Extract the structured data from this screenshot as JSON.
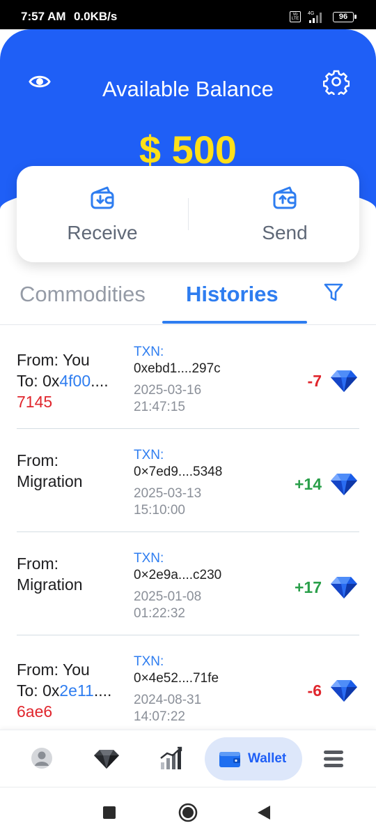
{
  "status_bar": {
    "time": "7:57 AM",
    "network_speed": "0.0KB/s",
    "volte": "Vo LTE",
    "network_type": "4G",
    "battery": "96"
  },
  "header": {
    "title": "Available Balance",
    "balance": "$ 500",
    "eye_icon": "eye-icon",
    "settings_icon": "gear-icon",
    "background_color": "#1f5ff6",
    "balance_color": "#ffe01a"
  },
  "actions": {
    "receive_label": "Receive",
    "send_label": "Send"
  },
  "tabs": {
    "commodities": "Commodities",
    "histories": "Histories",
    "active": "Histories",
    "accent_color": "#2e7df0"
  },
  "history": [
    {
      "from": "From: You",
      "to_prefix": "To: 0x",
      "to_highlight": "4f00",
      "to_suffix": "....",
      "to_tail": "7145",
      "txn_label": "TXN:",
      "txn_hash": "0xebd1....297c",
      "date": "2025-03-16",
      "time": "21:47:15",
      "amount": "-7"
    },
    {
      "from": "From:",
      "from_line2": "Migration",
      "txn_label": "TXN:",
      "txn_hash": "0×7ed9....5348",
      "date": "2025-03-13",
      "time": "15:10:00",
      "amount": "+14"
    },
    {
      "from": "From:",
      "from_line2": "Migration",
      "txn_label": "TXN:",
      "txn_hash": "0×2e9a....c230",
      "date": "2025-01-08",
      "time": "01:22:32",
      "amount": "+17"
    },
    {
      "from": "From: You",
      "to_prefix": "To: 0x",
      "to_highlight": "2e11",
      "to_suffix": "....",
      "to_tail": "6ae6",
      "txn_label": "TXN:",
      "txn_hash": "0×4e52....71fe",
      "date": "2024-08-31",
      "time": "14:07:22",
      "amount": "-6"
    }
  ],
  "bottom_nav": {
    "active": "Wallet",
    "wallet_label": "Wallet",
    "items": [
      "profile-icon",
      "diamond-icon",
      "chart-icon",
      "wallet-icon",
      "menu-icon"
    ]
  },
  "system_nav": {
    "items": [
      "recent-apps-icon",
      "home-icon",
      "back-icon"
    ]
  }
}
